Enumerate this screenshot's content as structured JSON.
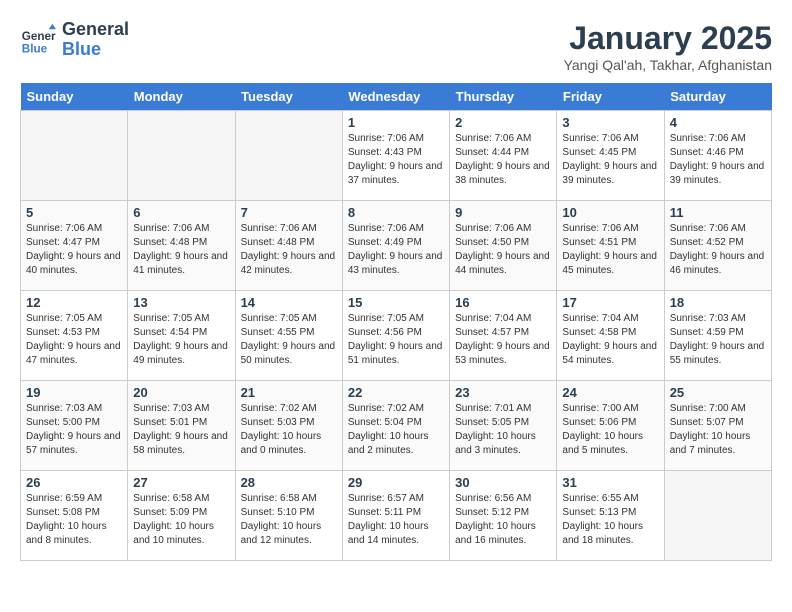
{
  "header": {
    "logo_line1": "General",
    "logo_line2": "Blue",
    "title": "January 2025",
    "subtitle": "Yangi Qal'ah, Takhar, Afghanistan"
  },
  "weekdays": [
    "Sunday",
    "Monday",
    "Tuesday",
    "Wednesday",
    "Thursday",
    "Friday",
    "Saturday"
  ],
  "weeks": [
    [
      {
        "day": "",
        "empty": true
      },
      {
        "day": "",
        "empty": true
      },
      {
        "day": "",
        "empty": true
      },
      {
        "day": "1",
        "sunrise": "7:06 AM",
        "sunset": "4:43 PM",
        "daylight": "9 hours and 37 minutes."
      },
      {
        "day": "2",
        "sunrise": "7:06 AM",
        "sunset": "4:44 PM",
        "daylight": "9 hours and 38 minutes."
      },
      {
        "day": "3",
        "sunrise": "7:06 AM",
        "sunset": "4:45 PM",
        "daylight": "9 hours and 39 minutes."
      },
      {
        "day": "4",
        "sunrise": "7:06 AM",
        "sunset": "4:46 PM",
        "daylight": "9 hours and 39 minutes."
      }
    ],
    [
      {
        "day": "5",
        "sunrise": "7:06 AM",
        "sunset": "4:47 PM",
        "daylight": "9 hours and 40 minutes."
      },
      {
        "day": "6",
        "sunrise": "7:06 AM",
        "sunset": "4:48 PM",
        "daylight": "9 hours and 41 minutes."
      },
      {
        "day": "7",
        "sunrise": "7:06 AM",
        "sunset": "4:48 PM",
        "daylight": "9 hours and 42 minutes."
      },
      {
        "day": "8",
        "sunrise": "7:06 AM",
        "sunset": "4:49 PM",
        "daylight": "9 hours and 43 minutes."
      },
      {
        "day": "9",
        "sunrise": "7:06 AM",
        "sunset": "4:50 PM",
        "daylight": "9 hours and 44 minutes."
      },
      {
        "day": "10",
        "sunrise": "7:06 AM",
        "sunset": "4:51 PM",
        "daylight": "9 hours and 45 minutes."
      },
      {
        "day": "11",
        "sunrise": "7:06 AM",
        "sunset": "4:52 PM",
        "daylight": "9 hours and 46 minutes."
      }
    ],
    [
      {
        "day": "12",
        "sunrise": "7:05 AM",
        "sunset": "4:53 PM",
        "daylight": "9 hours and 47 minutes."
      },
      {
        "day": "13",
        "sunrise": "7:05 AM",
        "sunset": "4:54 PM",
        "daylight": "9 hours and 49 minutes."
      },
      {
        "day": "14",
        "sunrise": "7:05 AM",
        "sunset": "4:55 PM",
        "daylight": "9 hours and 50 minutes."
      },
      {
        "day": "15",
        "sunrise": "7:05 AM",
        "sunset": "4:56 PM",
        "daylight": "9 hours and 51 minutes."
      },
      {
        "day": "16",
        "sunrise": "7:04 AM",
        "sunset": "4:57 PM",
        "daylight": "9 hours and 53 minutes."
      },
      {
        "day": "17",
        "sunrise": "7:04 AM",
        "sunset": "4:58 PM",
        "daylight": "9 hours and 54 minutes."
      },
      {
        "day": "18",
        "sunrise": "7:03 AM",
        "sunset": "4:59 PM",
        "daylight": "9 hours and 55 minutes."
      }
    ],
    [
      {
        "day": "19",
        "sunrise": "7:03 AM",
        "sunset": "5:00 PM",
        "daylight": "9 hours and 57 minutes."
      },
      {
        "day": "20",
        "sunrise": "7:03 AM",
        "sunset": "5:01 PM",
        "daylight": "9 hours and 58 minutes."
      },
      {
        "day": "21",
        "sunrise": "7:02 AM",
        "sunset": "5:03 PM",
        "daylight": "10 hours and 0 minutes."
      },
      {
        "day": "22",
        "sunrise": "7:02 AM",
        "sunset": "5:04 PM",
        "daylight": "10 hours and 2 minutes."
      },
      {
        "day": "23",
        "sunrise": "7:01 AM",
        "sunset": "5:05 PM",
        "daylight": "10 hours and 3 minutes."
      },
      {
        "day": "24",
        "sunrise": "7:00 AM",
        "sunset": "5:06 PM",
        "daylight": "10 hours and 5 minutes."
      },
      {
        "day": "25",
        "sunrise": "7:00 AM",
        "sunset": "5:07 PM",
        "daylight": "10 hours and 7 minutes."
      }
    ],
    [
      {
        "day": "26",
        "sunrise": "6:59 AM",
        "sunset": "5:08 PM",
        "daylight": "10 hours and 8 minutes."
      },
      {
        "day": "27",
        "sunrise": "6:58 AM",
        "sunset": "5:09 PM",
        "daylight": "10 hours and 10 minutes."
      },
      {
        "day": "28",
        "sunrise": "6:58 AM",
        "sunset": "5:10 PM",
        "daylight": "10 hours and 12 minutes."
      },
      {
        "day": "29",
        "sunrise": "6:57 AM",
        "sunset": "5:11 PM",
        "daylight": "10 hours and 14 minutes."
      },
      {
        "day": "30",
        "sunrise": "6:56 AM",
        "sunset": "5:12 PM",
        "daylight": "10 hours and 16 minutes."
      },
      {
        "day": "31",
        "sunrise": "6:55 AM",
        "sunset": "5:13 PM",
        "daylight": "10 hours and 18 minutes."
      },
      {
        "day": "",
        "empty": true
      }
    ]
  ]
}
